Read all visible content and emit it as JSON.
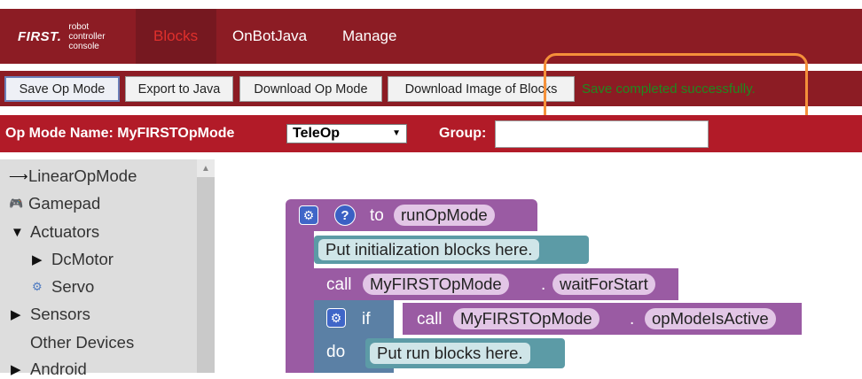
{
  "logo": {
    "wordmark": "FIRST.",
    "subtitle_lines": [
      "robot",
      "controller",
      "console"
    ]
  },
  "nav": {
    "tabs": [
      {
        "label": "Blocks",
        "active": true
      },
      {
        "label": "OnBotJava"
      },
      {
        "label": "Manage"
      }
    ]
  },
  "toolbar": {
    "save_label": "Save Op Mode",
    "export_label": "Export to Java",
    "download_label": "Download Op Mode",
    "download_image_label": "Download Image of Blocks",
    "status_text": "Save completed successfully."
  },
  "opmode": {
    "name_label": "Op Mode Name: MyFIRSTOpMode",
    "type_value": "TeleOp",
    "group_label": "Group:",
    "group_value": ""
  },
  "sidebar": {
    "items": [
      {
        "glyph": "⟶",
        "label": "LinearOpMode"
      },
      {
        "glyph": "🎮",
        "label": "Gamepad"
      },
      {
        "glyph": "▼",
        "label": "Actuators"
      },
      {
        "glyph": "▶",
        "label": "DcMotor"
      },
      {
        "glyph": "⚙",
        "label": "Servo"
      },
      {
        "glyph": "▶",
        "label": "Sensors"
      },
      {
        "glyph": "",
        "label": "Other Devices"
      },
      {
        "glyph": "▶",
        "label": "Android"
      }
    ]
  },
  "blocks": {
    "to": "to",
    "function_name": "runOpMode",
    "init_comment": "Put initialization blocks here.",
    "call": "call",
    "object_name": "MyFIRSTOpMode",
    "dot": ".",
    "wait_method": "waitForStart",
    "if": "if",
    "active_method": "opModeIsActive",
    "do": "do",
    "run_comment": "Put run blocks here.",
    "gear_glyph": "⚙",
    "help_glyph": "?"
  },
  "colors": {
    "navbar": "#8c1c24",
    "opbar": "#b21b28",
    "status_green": "#1f8a1f",
    "highlight_orange": "#f5903a",
    "procedure_purple": "#9a5ba3",
    "control_blue": "#5b80a5",
    "comment_teal": "#5c9ba6"
  }
}
